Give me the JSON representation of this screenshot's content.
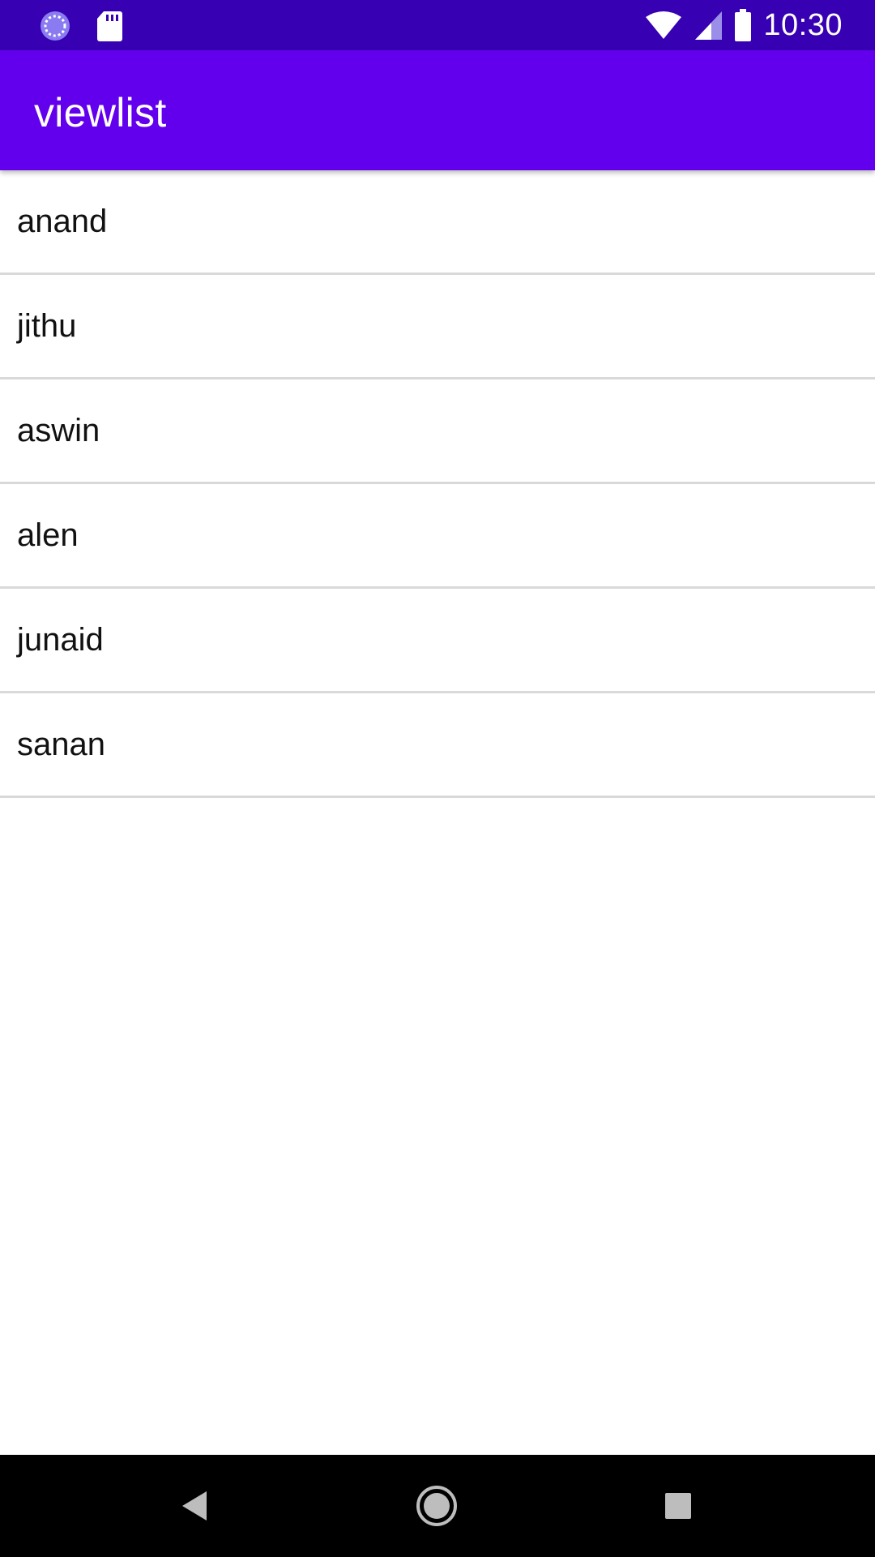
{
  "status_bar": {
    "time": "10:30",
    "left_icons": [
      "sync-icon",
      "sd-card-icon"
    ],
    "right_icons": [
      "wifi-icon",
      "cell-signal-icon",
      "battery-icon"
    ]
  },
  "app_bar": {
    "title": "viewlist"
  },
  "list": {
    "items": [
      {
        "label": "anand"
      },
      {
        "label": "jithu"
      },
      {
        "label": "aswin"
      },
      {
        "label": "alen"
      },
      {
        "label": "junaid"
      },
      {
        "label": "sanan"
      }
    ]
  },
  "nav_bar": {
    "buttons": [
      "back-icon",
      "home-icon",
      "recents-icon"
    ]
  },
  "colors": {
    "status_bar": "#3700B3",
    "app_bar": "#6200EE",
    "divider": "#D9D9D9",
    "nav_bar": "#000000"
  }
}
